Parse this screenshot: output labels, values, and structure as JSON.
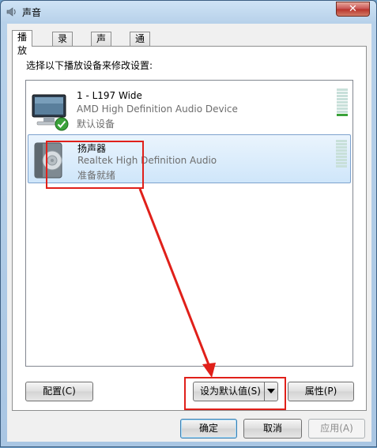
{
  "window": {
    "title": "声音",
    "close_glyph": "✕"
  },
  "tabs": [
    {
      "label": "播放"
    },
    {
      "label": "录制"
    },
    {
      "label": "声音"
    },
    {
      "label": "通信"
    }
  ],
  "instruction": "选择以下播放设备来修改设置:",
  "devices": [
    {
      "name": "1 - L197 Wide",
      "description": "AMD High Definition Audio Device",
      "status": "默认设备",
      "icon": "monitor-icon",
      "badge": "default-check-icon"
    },
    {
      "name": "扬声器",
      "description": "Realtek High Definition Audio",
      "status": "准备就绪",
      "icon": "speaker-icon"
    }
  ],
  "buttons": {
    "configure": "配置(C)",
    "set_default": "设为默认值(S)",
    "properties": "属性(P)",
    "ok": "确定",
    "cancel": "取消",
    "apply": "应用(A)"
  },
  "colors": {
    "annotation": "#e0201a",
    "selection": "#cfe6fa",
    "check": "#3aa23a"
  }
}
